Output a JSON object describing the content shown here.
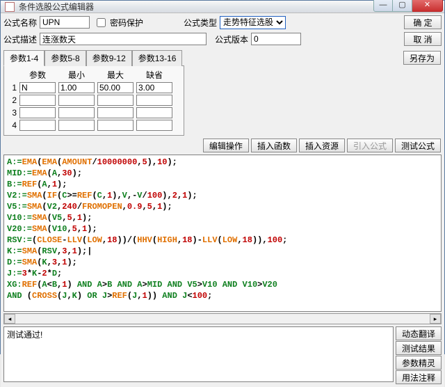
{
  "window": {
    "title": "条件选股公式编辑器"
  },
  "labels": {
    "name": "公式名称",
    "pwd": "密码保护",
    "type": "公式类型",
    "desc": "公式描述",
    "version": "公式版本"
  },
  "fields": {
    "name": "UPN",
    "desc": "连涨数天",
    "type_selected": "走势特征选股",
    "version": "0"
  },
  "buttons": {
    "ok": "确  定",
    "cancel": "取  消",
    "saveas": "另存为",
    "edit_ops": "编辑操作",
    "ins_fn": "插入函数",
    "ins_res": "插入资源",
    "import": "引入公式",
    "test": "测试公式",
    "dyn": "动态翻译",
    "result": "测试结果",
    "wizard": "参数精灵",
    "usage": "用法注释"
  },
  "tabs": [
    "参数1-4",
    "参数5-8",
    "参数9-12",
    "参数13-16"
  ],
  "param_headers": {
    "name": "参数",
    "min": "最小",
    "max": "最大",
    "def": "缺省"
  },
  "params": [
    {
      "idx": "1",
      "name": "N",
      "min": "1.00",
      "max": "50.00",
      "def": "3.00"
    },
    {
      "idx": "2",
      "name": "",
      "min": "",
      "max": "",
      "def": ""
    },
    {
      "idx": "3",
      "name": "",
      "min": "",
      "max": "",
      "def": ""
    },
    {
      "idx": "4",
      "name": "",
      "min": "",
      "max": "",
      "def": ""
    }
  ],
  "output": "测试通过!",
  "code": [
    [
      [
        "var",
        "A:="
      ],
      [
        "fn",
        "EMA"
      ],
      [
        "sym",
        "("
      ],
      [
        "fn",
        "EMA"
      ],
      [
        "sym",
        "("
      ],
      [
        "fn",
        "AMOUNT"
      ],
      [
        "sym",
        "/"
      ],
      [
        "num",
        "10000000"
      ],
      [
        "sym",
        "*"
      ],
      [
        "num",
        "5"
      ],
      [
        "sym",
        "),"
      ],
      [
        "num",
        "10"
      ],
      [
        "sym",
        ");"
      ]
    ],
    [
      [
        "var",
        "MID:="
      ],
      [
        "fn",
        "EMA"
      ],
      [
        "sym",
        "("
      ],
      [
        "var",
        "A"
      ],
      [
        "sym",
        "*"
      ],
      [
        "num",
        "30"
      ],
      [
        "sym",
        ");"
      ]
    ],
    [
      [
        "var",
        "B:="
      ],
      [
        "fn",
        "REF"
      ],
      [
        "sym",
        "("
      ],
      [
        "var",
        "A"
      ],
      [
        "sym",
        "*"
      ],
      [
        "num",
        "1"
      ],
      [
        "sym",
        ");"
      ]
    ],
    [
      [
        "var",
        "V2:="
      ],
      [
        "fn",
        "SMA"
      ],
      [
        "sym",
        "("
      ],
      [
        "fn",
        "IF"
      ],
      [
        "sym",
        "("
      ],
      [
        "var",
        "C"
      ],
      [
        "sym",
        ">="
      ],
      [
        "fn",
        "REF"
      ],
      [
        "sym",
        "("
      ],
      [
        "var",
        "C"
      ],
      [
        "sym",
        "*"
      ],
      [
        "num",
        "1"
      ],
      [
        "sym",
        "),"
      ],
      [
        "var",
        "V"
      ],
      [
        "sym",
        ",­-"
      ],
      [
        "var",
        "V"
      ],
      [
        "sym",
        "/"
      ],
      [
        "num",
        "100"
      ],
      [
        "sym",
        "),"
      ],
      [
        "num",
        "2"
      ],
      [
        "sym",
        "*"
      ],
      [
        "num",
        "1"
      ],
      [
        "sym",
        ");"
      ]
    ],
    [
      [
        "var",
        "V5:="
      ],
      [
        "fn",
        "SMA"
      ],
      [
        "sym",
        "("
      ],
      [
        "var",
        "V2"
      ],
      [
        "sym",
        "*"
      ],
      [
        "num",
        "240"
      ],
      [
        "sym",
        "/"
      ],
      [
        "fn",
        "FROMOPEN"
      ],
      [
        "sym",
        "*"
      ],
      [
        "num",
        "0.9"
      ],
      [
        "sym",
        "*"
      ],
      [
        "num",
        "5"
      ],
      [
        "sym",
        "*"
      ],
      [
        "num",
        "1"
      ],
      [
        "sym",
        ");"
      ]
    ],
    [
      [
        "var",
        "V10:="
      ],
      [
        "fn",
        "SMA"
      ],
      [
        "sym",
        "("
      ],
      [
        "var",
        "V5"
      ],
      [
        "sym",
        "*"
      ],
      [
        "num",
        "5"
      ],
      [
        "sym",
        "*"
      ],
      [
        "num",
        "1"
      ],
      [
        "sym",
        ");"
      ]
    ],
    [
      [
        "var",
        "V20:="
      ],
      [
        "fn",
        "SMA"
      ],
      [
        "sym",
        "("
      ],
      [
        "var",
        "V10"
      ],
      [
        "sym",
        "*"
      ],
      [
        "num",
        "5"
      ],
      [
        "sym",
        "*"
      ],
      [
        "num",
        "1"
      ],
      [
        "sym",
        ");"
      ]
    ],
    [
      [
        "var",
        "RSV:="
      ],
      [
        "sym",
        "("
      ],
      [
        "fn",
        "CLOSE"
      ],
      [
        "sym",
        "-"
      ],
      [
        "fn",
        "LLV"
      ],
      [
        "sym",
        "("
      ],
      [
        "fn",
        "LOW"
      ],
      [
        "sym",
        "*"
      ],
      [
        "num",
        "18"
      ],
      [
        "sym",
        "))/("
      ],
      [
        "fn",
        "HHV"
      ],
      [
        "sym",
        "("
      ],
      [
        "fn",
        "HIGH"
      ],
      [
        "sym",
        "*"
      ],
      [
        "num",
        "18"
      ],
      [
        "sym",
        ")-"
      ],
      [
        "fn",
        "LLV"
      ],
      [
        "sym",
        "("
      ],
      [
        "fn",
        "LOW"
      ],
      [
        "sym",
        "*"
      ],
      [
        "num",
        "18"
      ],
      [
        "sym",
        "))*"
      ],
      [
        "num",
        "100"
      ],
      [
        "sym",
        ";"
      ]
    ],
    [
      [
        "var",
        "K:="
      ],
      [
        "fn",
        "SMA"
      ],
      [
        "sym",
        "("
      ],
      [
        "var",
        "RSV"
      ],
      [
        "sym",
        "*"
      ],
      [
        "num",
        "3"
      ],
      [
        "sym",
        "*"
      ],
      [
        "num",
        "1"
      ],
      [
        "sym",
        ");"
      ],
      [
        "plain",
        "|"
      ]
    ],
    [
      [
        "var",
        "D:="
      ],
      [
        "fn",
        "SMA"
      ],
      [
        "sym",
        "("
      ],
      [
        "var",
        "K"
      ],
      [
        "sym",
        "*"
      ],
      [
        "num",
        "3"
      ],
      [
        "sym",
        "*"
      ],
      [
        "num",
        "1"
      ],
      [
        "sym",
        ");"
      ]
    ],
    [
      [
        "var",
        "J:="
      ],
      [
        "num",
        "3"
      ],
      [
        "sym",
        "*"
      ],
      [
        "var",
        "K"
      ],
      [
        "sym",
        "-"
      ],
      [
        "num",
        "2"
      ],
      [
        "sym",
        "*"
      ],
      [
        "var",
        "D"
      ],
      [
        "sym",
        ";"
      ]
    ],
    [
      [
        "var",
        "XG:"
      ],
      [
        "fn",
        "REF"
      ],
      [
        "sym",
        "("
      ],
      [
        "var",
        "A"
      ],
      [
        "sym",
        "<"
      ],
      [
        "var",
        "B"
      ],
      [
        "sym",
        "*"
      ],
      [
        "num",
        "1"
      ],
      [
        "sym",
        ") "
      ],
      [
        "kw",
        "AND"
      ],
      [
        "sym",
        " "
      ],
      [
        "var",
        "A"
      ],
      [
        "sym",
        ">"
      ],
      [
        "var",
        "B"
      ],
      [
        "sym",
        " "
      ],
      [
        "kw",
        "AND"
      ],
      [
        "sym",
        " "
      ],
      [
        "var",
        "A"
      ],
      [
        "sym",
        ">"
      ],
      [
        "var",
        "MID"
      ],
      [
        "sym",
        " "
      ],
      [
        "kw",
        "AND"
      ],
      [
        "sym",
        " "
      ],
      [
        "var",
        "V5"
      ],
      [
        "sym",
        ">"
      ],
      [
        "var",
        "V10"
      ],
      [
        "sym",
        " "
      ],
      [
        "kw",
        "AND"
      ],
      [
        "sym",
        " "
      ],
      [
        "var",
        "V10"
      ],
      [
        "sym",
        ">"
      ],
      [
        "var",
        "V20"
      ]
    ],
    [
      [
        "kw",
        "AND"
      ],
      [
        "sym",
        " ("
      ],
      [
        "fn",
        "CROSS"
      ],
      [
        "sym",
        "("
      ],
      [
        "var",
        "J"
      ],
      [
        "sym",
        "*"
      ],
      [
        "var",
        "K"
      ],
      [
        "sym",
        ") "
      ],
      [
        "kw",
        "OR"
      ],
      [
        "sym",
        " "
      ],
      [
        "var",
        "J"
      ],
      [
        "sym",
        ">"
      ],
      [
        "fn",
        "REF"
      ],
      [
        "sym",
        "("
      ],
      [
        "var",
        "J"
      ],
      [
        "sym",
        "*"
      ],
      [
        "num",
        "1"
      ],
      [
        "sym",
        ")) "
      ],
      [
        "kw",
        "AND"
      ],
      [
        "sym",
        " "
      ],
      [
        "var",
        "J"
      ],
      [
        "sym",
        "<"
      ],
      [
        "num",
        "100"
      ],
      [
        "sym",
        ";"
      ]
    ]
  ]
}
